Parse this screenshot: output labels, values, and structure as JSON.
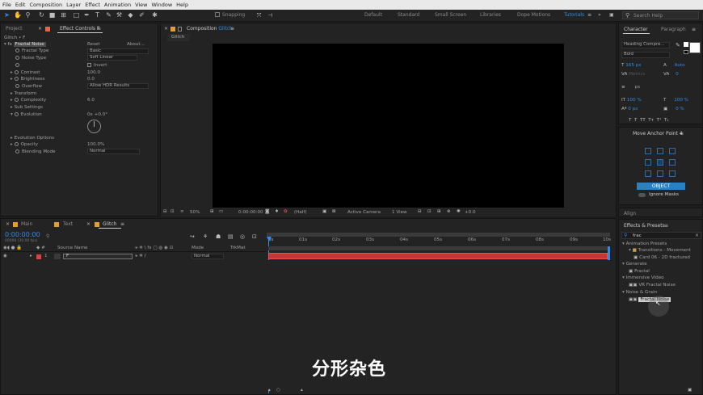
{
  "menu": [
    "File",
    "Edit",
    "Composition",
    "Layer",
    "Effect",
    "Animation",
    "View",
    "Window",
    "Help"
  ],
  "toolbar": {
    "snapping": "Snapping",
    "workspaces": [
      "Default",
      "Standard",
      "Small Screen",
      "Libraries",
      "Dope Motions",
      "Tutorials"
    ],
    "search_placeholder": "Search Help"
  },
  "left_panel": {
    "tab_project": "Project",
    "tab_effect_controls": "Effect Controls F",
    "layer_path": "Glitch • F",
    "effect_name": "Fractal Noise",
    "reset": "Reset",
    "about": "About...",
    "props": {
      "fractal_type": "Fractal Type",
      "fractal_type_val": "Basic",
      "noise_type": "Noise Type",
      "noise_type_val": "Soft Linear",
      "invert": "Invert",
      "contrast": "Contrast",
      "contrast_val": "100.0",
      "brightness": "Brightness",
      "brightness_val": "0.0",
      "overflow": "Overflow",
      "overflow_val": "Allow HDR Results",
      "transform": "Transform",
      "complexity": "Complexity",
      "complexity_val": "6.0",
      "sub_settings": "Sub Settings",
      "evolution": "Evolution",
      "evolution_val": "0x +0.0°",
      "evolution_options": "Evolution Options",
      "opacity": "Opacity",
      "opacity_val": "100.0%",
      "blending_mode": "Blending Mode",
      "blending_mode_val": "Normal"
    }
  },
  "comp_panel": {
    "tab_label": "Composition",
    "tab_name": "Glitch",
    "sub_tab": "Glitch",
    "zoom": "50%",
    "timecode": "0:00:00:00",
    "resolution": "(Half)",
    "camera": "Active Camera",
    "view": "1 View",
    "exposure": "+0.0"
  },
  "right_panel": {
    "tab_character": "Character",
    "tab_paragraph": "Paragraph",
    "font": "Heading Compre...",
    "style": "Bold",
    "font_size": "165 px",
    "leading": "Auto",
    "kerning": "Metrics",
    "tracking": "0",
    "px": "px",
    "vscale": "100 %",
    "hscale": "100 %",
    "baseline": "0 px",
    "tsume": "0 %",
    "text_buttons": [
      "T",
      "T",
      "TT",
      "Tт",
      "T¹",
      "T₁"
    ],
    "anchor_panel": "Move Anchor Point 4",
    "object_button": "OBJECT",
    "ignore_masks": "Ignore Masks",
    "align": "Align",
    "effects_presets": "Effects & Presets",
    "search_value": "frac",
    "tree": [
      {
        "label": "Animation Presets",
        "level": 0
      },
      {
        "label": "Transitions - Movement",
        "level": 1
      },
      {
        "label": "Card 06 - 2D fractured",
        "level": 2
      },
      {
        "label": "Generate",
        "level": 0
      },
      {
        "label": "Fractal",
        "level": 1
      },
      {
        "label": "Immersive Video",
        "level": 0
      },
      {
        "label": "VR Fractal Noise",
        "level": 1
      },
      {
        "label": "Noise & Grain",
        "level": 0
      },
      {
        "label": "Fractal Noise",
        "level": 1
      }
    ]
  },
  "timeline": {
    "tabs": [
      "Main",
      "Text",
      "Glitch"
    ],
    "timecode": "0:00:00:00",
    "fps_info": "00000 (30.00 fps)",
    "search_placeholder": "",
    "columns": {
      "source_name": "Source Name",
      "mode": "Mode",
      "trkmat": "TrkMat"
    },
    "layer_num": "1",
    "layer_name": "F",
    "layer_mode": "Normal",
    "ruler": [
      "0s",
      "01s",
      "02s",
      "03s",
      "04s",
      "05s",
      "06s",
      "07s",
      "08s",
      "09s",
      "10s"
    ]
  },
  "subtitle": "分形杂色"
}
